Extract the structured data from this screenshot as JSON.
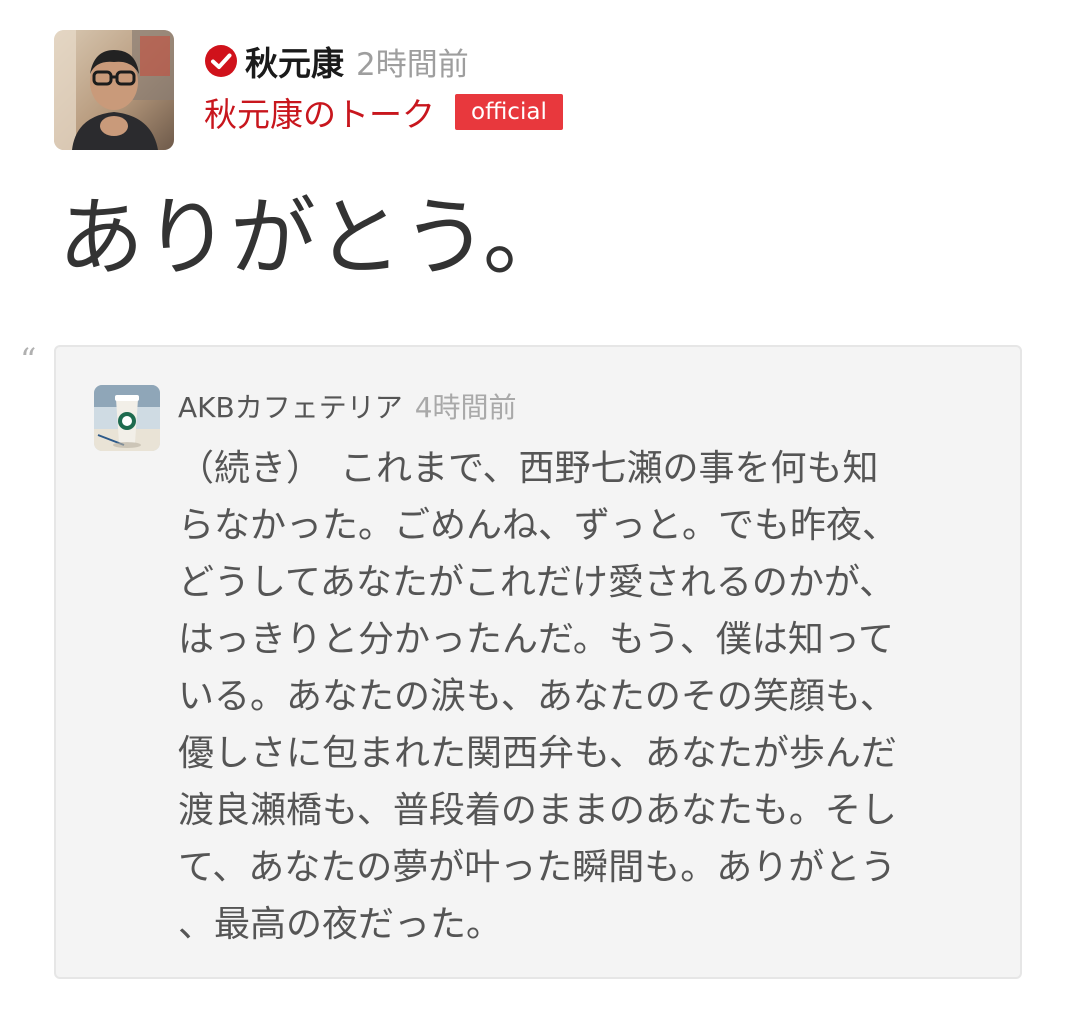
{
  "post": {
    "author": "秋元康",
    "time": "2時間前",
    "channel": "秋元康のトーク",
    "badge": "official",
    "title": "ありがとう。",
    "avatar_icon": "user-avatar-photo",
    "verified_icon": "verified-check-icon"
  },
  "quote": {
    "mark": "“",
    "author": "AKBカフェテリア",
    "time": "4時間前",
    "avatar_icon": "coffee-cup-avatar",
    "body": "（続き）　これまで、西野七瀬の事を何も知\nらなかった。ごめんね、ずっと。でも昨夜、\nどうしてあなたがこれだけ愛されるのかが、\nはっきりと分かったんだ。もう、僕は知って\nいる。あなたの涙も、あなたのその笑顔も、\n優しさに包まれた関西弁も、あなたが歩んだ\n渡良瀬橋も、普段着のままのあなたも。そし\nて、あなたの夢が叶った瞬間も。ありがとう\n、最高の夜だった。"
  },
  "colors": {
    "accent_red": "#c8161d",
    "badge_red": "#e8383d",
    "verified_red": "#d0121b",
    "card_bg": "#f4f4f4",
    "body_text": "#555555",
    "muted_text": "#9e9e9e"
  }
}
